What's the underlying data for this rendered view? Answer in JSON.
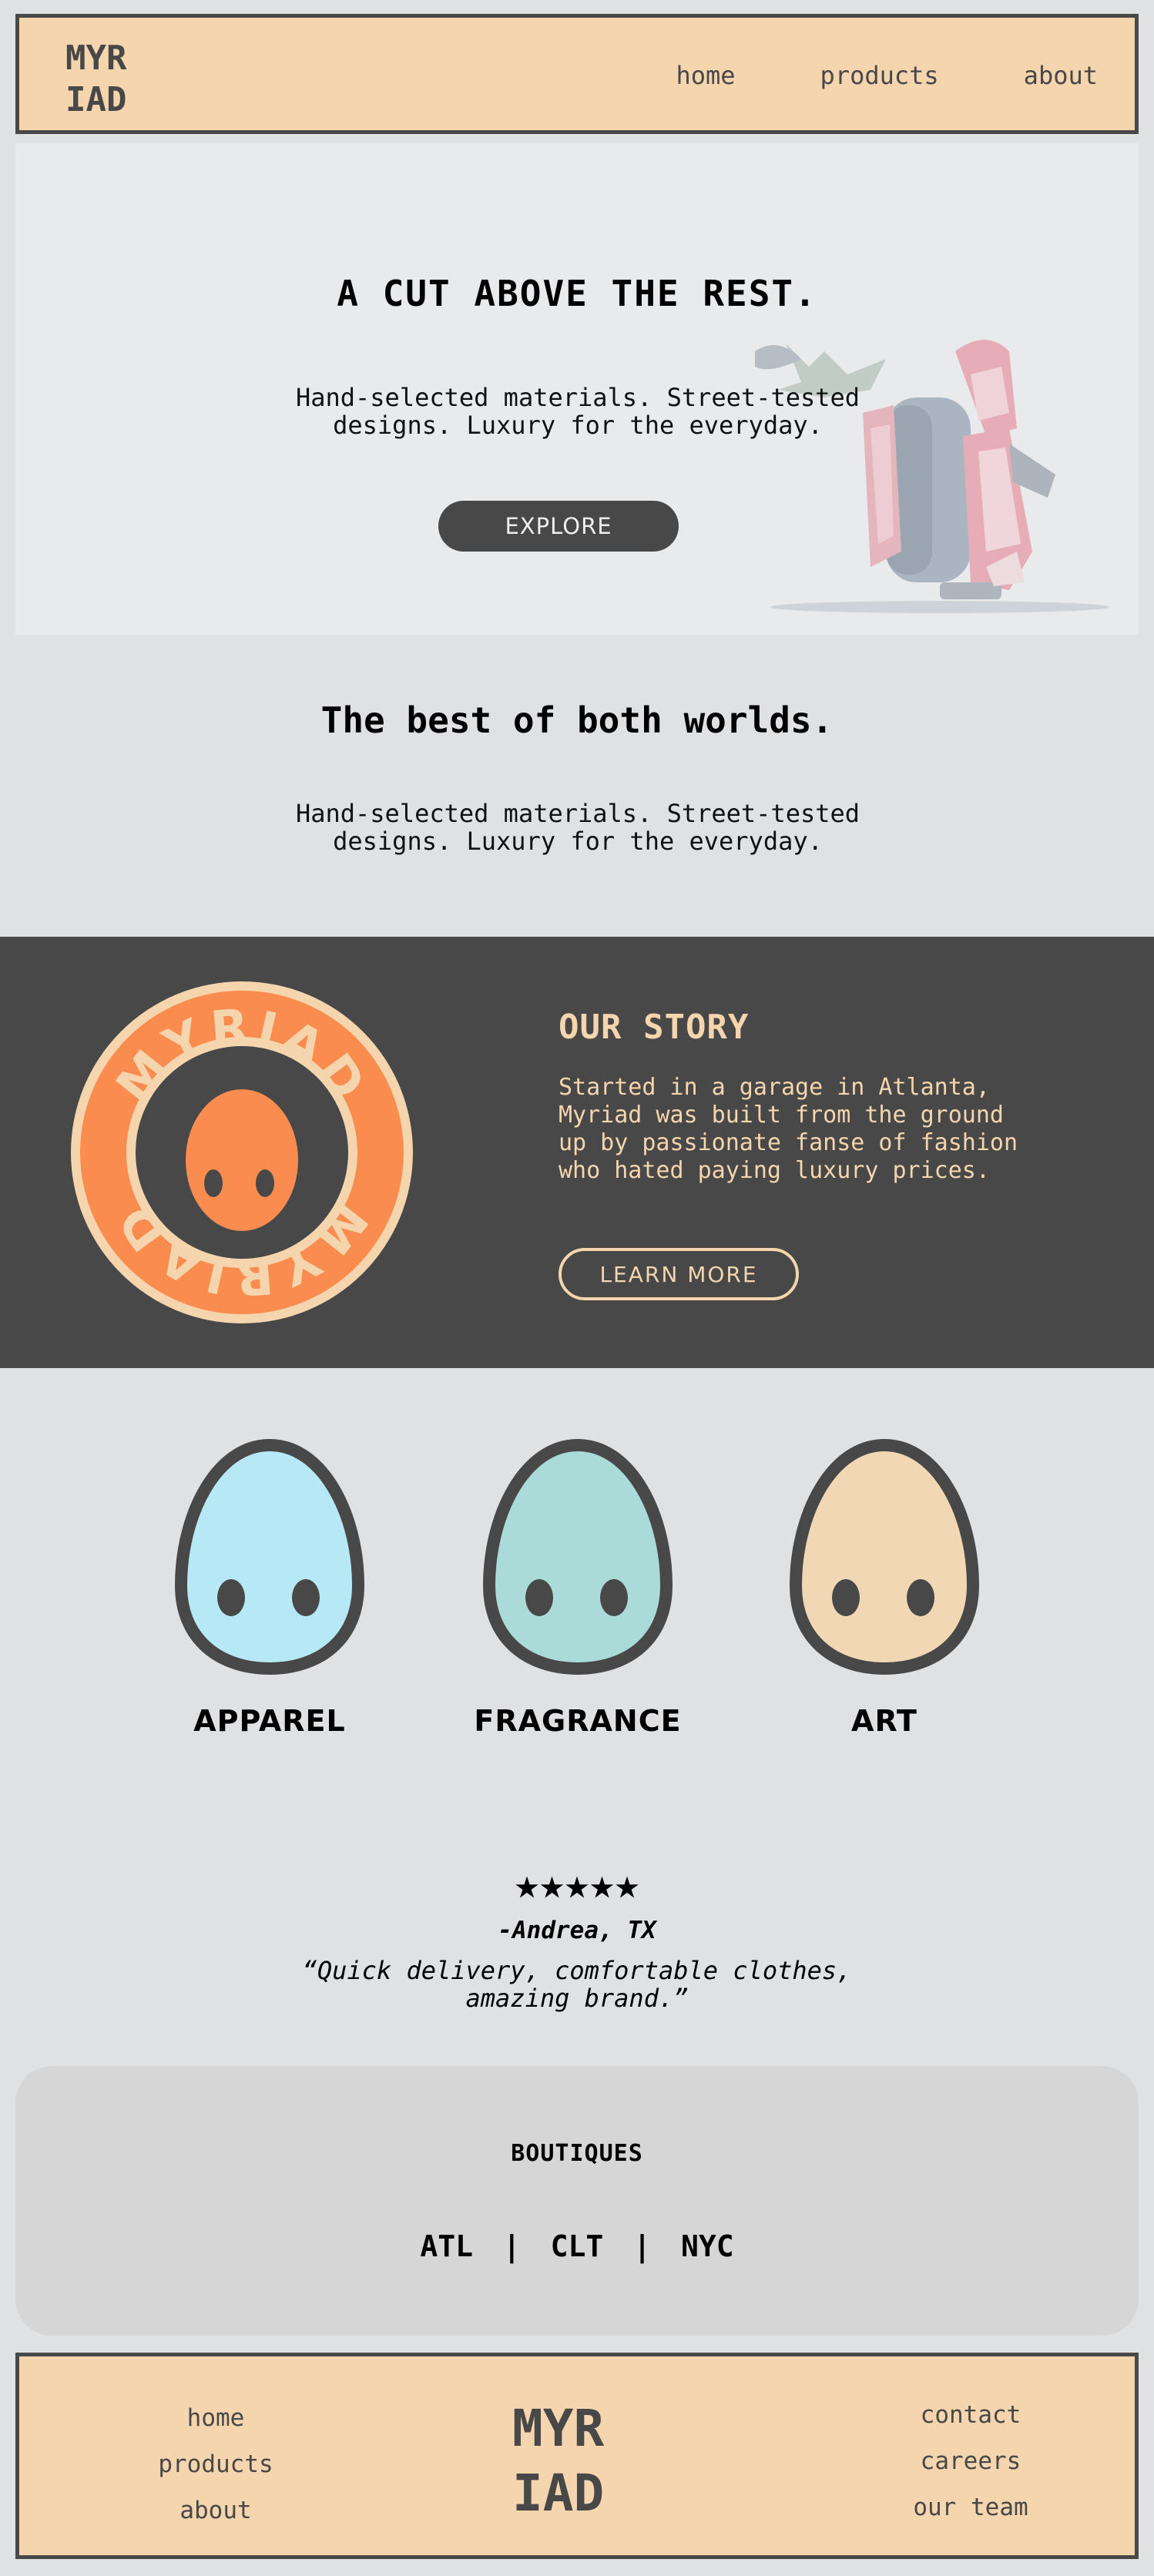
{
  "brand": {
    "logo_line1": "MYR",
    "logo_line2": "IAD"
  },
  "nav": {
    "items": [
      "home",
      "products",
      "about"
    ]
  },
  "hero": {
    "title": "A CUT ABOVE THE REST.",
    "subtitle": "Hand-selected materials. Street-tested designs. Luxury for the everyday.",
    "button": "EXPLORE"
  },
  "best": {
    "title": "The best of both worlds.",
    "subtitle": "Hand-selected materials. Street-tested designs. Luxury for the everyday."
  },
  "story": {
    "badge_text": "MYRIAD",
    "title": "OUR STORY",
    "text": "Started in a garage in Atlanta, Myriad was built from the ground up by passionate fanse of fashion who hated paying luxury prices.",
    "button": "LEARN MORE"
  },
  "categories": [
    {
      "label": "APPAREL",
      "color": "#b6e9f5"
    },
    {
      "label": "FRAGRANCE",
      "color": "#abdbd8"
    },
    {
      "label": "ART",
      "color": "#f2d7b5"
    }
  ],
  "testimonial": {
    "stars": "★★★★★",
    "author": "-Andrea, TX",
    "quote": "“Quick delivery, comfortable clothes, amazing brand.”"
  },
  "boutiques": {
    "title": "BOUTIQUES",
    "cities": "ATL | CLT | NYC"
  },
  "footer": {
    "left_links": [
      "home",
      "products",
      "about"
    ],
    "logo_line1": "MYR",
    "logo_line2": "IAD",
    "right_links": [
      "contact",
      "careers",
      "our team"
    ]
  },
  "colors": {
    "header_bg": "#f5d5ad",
    "dark": "#484848",
    "accent_orange": "#fa8c50",
    "page_bg": "#e0e1e3"
  }
}
